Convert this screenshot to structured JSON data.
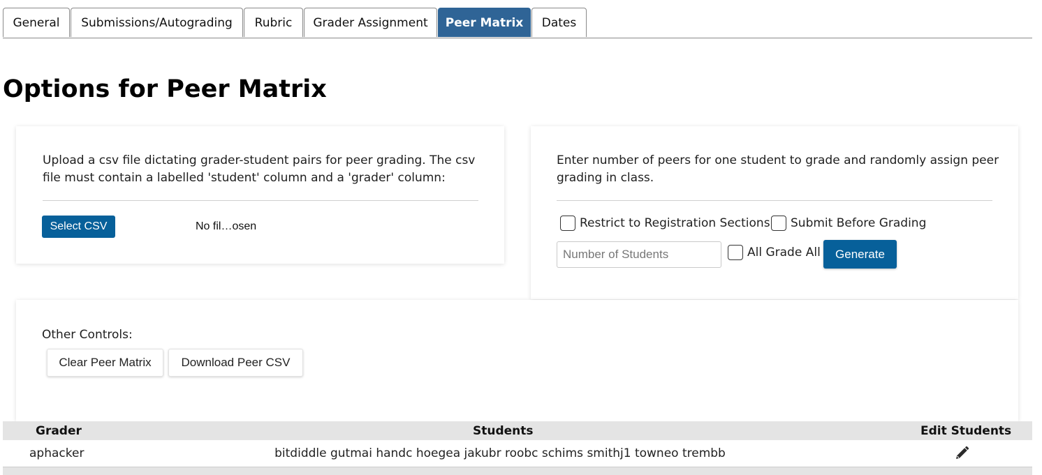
{
  "tabs": [
    {
      "label": "General"
    },
    {
      "label": "Submissions/Autograding"
    },
    {
      "label": "Rubric"
    },
    {
      "label": "Grader Assignment"
    },
    {
      "label": "Peer Matrix",
      "active": true
    },
    {
      "label": "Dates"
    }
  ],
  "page_title": "Options for Peer Matrix",
  "upload_card": {
    "description": "Upload a csv file dictating grader-student pairs for peer grading. The csv file must contain a labelled 'student' column and a 'grader' column:",
    "select_button": "Select CSV",
    "file_status": "No fil…osen"
  },
  "random_card": {
    "description": "Enter number of peers for one student to grade and randomly assign peer grading in class.",
    "restrict_label": "Restrict to Registration Sections",
    "submit_before_label": "Submit Before Grading",
    "number_placeholder": "Number of Students",
    "all_grade_all_label": "All Grade All",
    "generate_button": "Generate"
  },
  "other_controls": {
    "label": "Other Controls:",
    "clear_button": "Clear Peer Matrix",
    "download_button": "Download Peer CSV"
  },
  "table": {
    "headers": {
      "grader": "Grader",
      "students": "Students",
      "edit": "Edit Students"
    },
    "rows": [
      {
        "grader": "aphacker",
        "students": "bitdiddle gutmai handc hoegea jakubr roobc schims smithj1 towneo trembb"
      }
    ]
  },
  "colors": {
    "active_tab": "#2f6496",
    "primary_button": "#07609a",
    "table_header_bg": "#e4e4e4"
  },
  "icons": {
    "edit": "pencil-icon"
  }
}
